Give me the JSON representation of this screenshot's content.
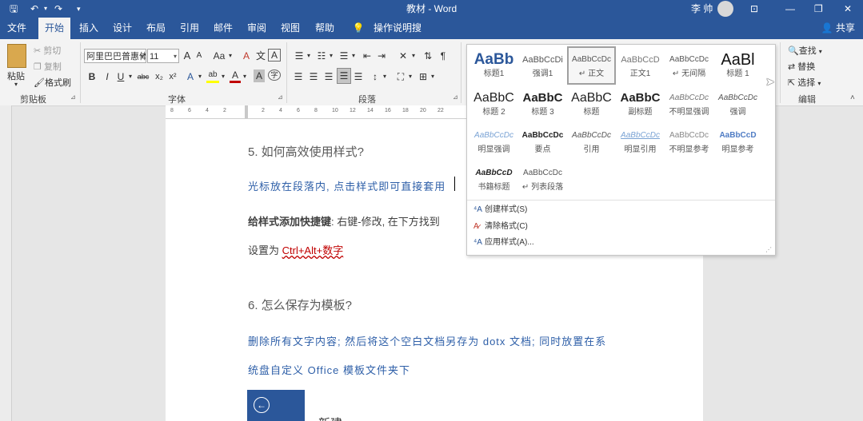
{
  "titlebar": {
    "title": "教材 - Word",
    "user": "李 帅",
    "qa_save": "🖫",
    "qa_undo": "↶",
    "qa_redo": "↷",
    "qa_more": "▾",
    "min": "—",
    "max": "❐",
    "close": "✕",
    "ribbon_opt": "⊡"
  },
  "tabs": [
    "文件",
    "开始",
    "插入",
    "设计",
    "布局",
    "引用",
    "邮件",
    "审阅",
    "视图",
    "帮助"
  ],
  "tell_me": "操作说明搜索",
  "share": "共享",
  "clipboard": {
    "paste": "粘贴",
    "cut": "剪切",
    "copy": "复制",
    "format_painter": "格式刷",
    "group": "剪贴板"
  },
  "font": {
    "name": "阿里巴巴普惠体",
    "size": "11",
    "group": "字体",
    "grow": "A",
    "shrink": "A",
    "case": "Aa",
    "clear": "A",
    "phonetic": "文",
    "border": "A",
    "bold": "B",
    "italic": "I",
    "underline": "U",
    "strike": "abc",
    "sub": "x₂",
    "sup": "x²",
    "effect": "A",
    "highlight": "ab",
    "color": "A",
    "shade": "A",
    "enclose": "字"
  },
  "paragraph": {
    "group": "段落"
  },
  "editing": {
    "find": "查找",
    "replace": "替换",
    "select": "选择",
    "group": "编辑"
  },
  "gallery": {
    "rows": [
      [
        {
          "preview": "AaBb",
          "name": "标题1"
        },
        {
          "preview": "AaBbCcDi",
          "name": "强调1"
        },
        {
          "preview": "AaBbCcDc",
          "name": "↵ 正文"
        },
        {
          "preview": "AaBbCcD",
          "name": "正文1"
        },
        {
          "preview": "AaBbCcDc",
          "name": "↵ 无间隔"
        },
        {
          "preview": "AaBl",
          "name": "标题 1"
        }
      ],
      [
        {
          "preview": "AaBbC",
          "name": "标题 2"
        },
        {
          "preview": "AaBbC",
          "name": "标题 3"
        },
        {
          "preview": "AaBbC",
          "name": "标题"
        },
        {
          "preview": "AaBbC",
          "name": "副标题"
        },
        {
          "preview": "AaBbCcDc",
          "name": "不明显强调"
        },
        {
          "preview": "AaBbCcDc",
          "name": "强调"
        }
      ],
      [
        {
          "preview": "AaBbCcDc",
          "name": "明显强调"
        },
        {
          "preview": "AaBbCcDc",
          "name": "要点"
        },
        {
          "preview": "AaBbCcDc",
          "name": "引用"
        },
        {
          "preview": "AaBbCcDc",
          "name": "明显引用"
        },
        {
          "preview": "AaBbCcDc",
          "name": "不明显参考"
        },
        {
          "preview": "AaBbCcD",
          "name": "明显参考"
        }
      ],
      [
        {
          "preview": "AaBbCcD",
          "name": "书籍标题"
        },
        {
          "preview": "AaBbCcDc",
          "name": "↵ 列表段落"
        }
      ]
    ],
    "create": "创建样式(S)",
    "clear": "清除格式(C)",
    "apply": "应用样式(A)..."
  },
  "ruler": [
    "8",
    "6",
    "4",
    "2",
    "",
    "2",
    "4",
    "6",
    "8",
    "10",
    "12",
    "14",
    "16",
    "18",
    "20",
    "22"
  ],
  "document": {
    "h5": "5. 如何高效使用样式?",
    "p1": "光标放在段落内, 点击样式即可直接套用",
    "p2_bold": "给样式添加快捷键",
    "p2_rest": ": 右键-修改, 在下方找到",
    "p3_pre": "设置为 ",
    "p3_red": "Ctrl+Alt+数字",
    "h6": "6. 怎么保存为模板?",
    "p4": "删除所有文字内容; 然后将这个空白文档另存为 dotx 文档; 同时放置在系",
    "p5": "统盘自定义 Office 模板文件夹下",
    "back_icon": "⊖",
    "bottom_text": "新建"
  },
  "colors": {
    "accent": "#2b579a",
    "ribbon": "#f3f3f3",
    "doc_blue": "#2e5fa8",
    "doc_red": "#c00000"
  }
}
